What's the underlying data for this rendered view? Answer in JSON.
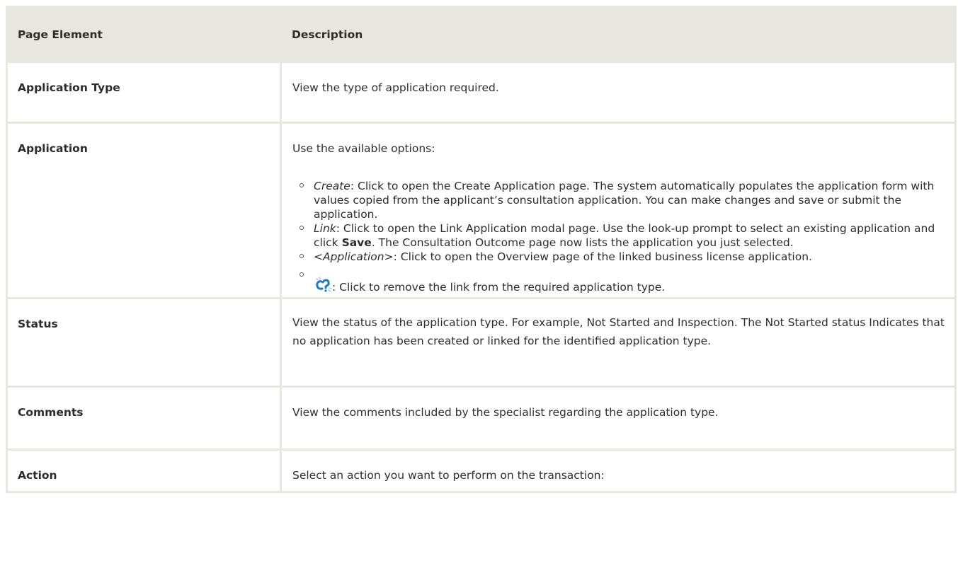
{
  "table": {
    "header": {
      "col1": "Page Element",
      "col2": "Description"
    },
    "rows": [
      {
        "term": "Application Type",
        "desc": "View the type of application required."
      },
      {
        "term": "Application",
        "intro": "Use the available options:",
        "options": [
          {
            "term": "Create",
            "text": ": Click to open the Create Application page. The system automatically populates the application form with values copied from the applicant’s consultation application. You can make changes and save or submit the application."
          },
          {
            "term": "Link",
            "text_before_bold": ": Click to open the Link Application modal page. Use the look-up prompt to select an existing application and click ",
            "bold": "Save",
            "text_after_bold": ". The Consultation Outcome page now lists the application you just selected."
          },
          {
            "term": "<Application>",
            "text": ": Click to open the Overview page of the linked business license application."
          },
          {
            "icon": "unlink-icon",
            "text": ": Click to remove the link from the required application type."
          }
        ]
      },
      {
        "term": "Status",
        "desc": "View the status of the application type. For example, Not Started and Inspection. The Not Started status Indicates that no application has been created or linked for the identified application type."
      },
      {
        "term": "Comments",
        "desc": "View the comments included by the specialist regarding the application type."
      },
      {
        "term": "Action",
        "desc": "Select an action you want to perform on the transaction:"
      }
    ]
  },
  "colors": {
    "header_bg": "#e8e6e1",
    "border": "#e8e6e1",
    "icon_blue": "#1a7bc4"
  }
}
